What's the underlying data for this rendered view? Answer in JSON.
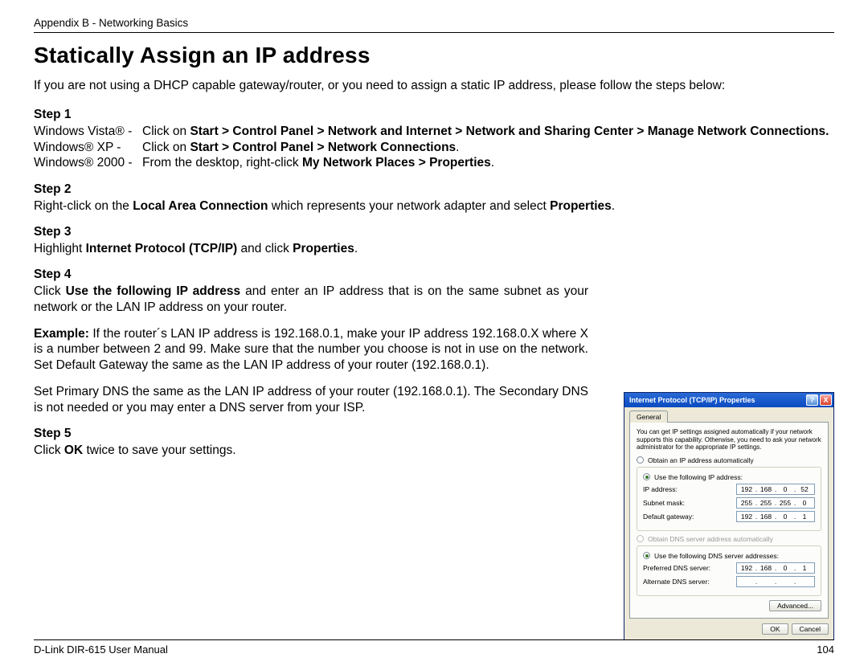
{
  "header": {
    "appendix": "Appendix B - Networking Basics"
  },
  "title": "Statically Assign an IP address",
  "intro": "If you are not using a DHCP capable gateway/router, or you need to assign a static IP address, please follow the steps below:",
  "step1": {
    "label": "Step 1",
    "vista_os": "Windows Vista® -",
    "vista_pre": "Click on ",
    "vista_bold": "Start > Control Panel > Network and Internet > Network and Sharing Center > Manage Network Connections.",
    "xp_os": "Windows® XP -",
    "xp_pre": "Click on ",
    "xp_bold": "Start > Control Panel > Network Connections",
    "xp_post": ".",
    "w2k_os": "Windows® 2000 -",
    "w2k_pre": "From the desktop, right-click ",
    "w2k_bold": "My Network Places > Properties",
    "w2k_post": "."
  },
  "step2": {
    "label": "Step 2",
    "pre": "Right-click on the ",
    "bold1": "Local Area Connection",
    "mid": " which represents your network adapter and select ",
    "bold2": "Properties",
    "post": "."
  },
  "step3": {
    "label": "Step 3",
    "pre": "Highlight ",
    "bold1": "Internet Protocol (TCP/IP)",
    "mid": " and click ",
    "bold2": "Properties",
    "post": "."
  },
  "step4": {
    "label": "Step 4",
    "p1_pre": "Click ",
    "p1_bold": "Use the following IP address",
    "p1_post": " and enter an IP address that is on the same subnet as your network or the LAN IP address on your router.",
    "p2_bold": "Example:",
    "p2_text": " If the router´s LAN IP address is 192.168.0.1, make your IP address 192.168.0.X where X is a number between 2 and 99. Make sure that the number you choose is not in use on the network. Set Default Gateway the same as the LAN IP address of your router (192.168.0.1).",
    "p3_text": "Set Primary DNS the same as the LAN IP address of your router (192.168.0.1). The Secondary DNS is not needed or you may enter a DNS server from your ISP."
  },
  "step5": {
    "label": "Step 5",
    "pre": "Click ",
    "bold": "OK",
    "post": " twice to save your settings."
  },
  "footer": {
    "manual": "D-Link DIR-615 User Manual",
    "page": "104"
  },
  "dialog": {
    "title": "Internet Protocol (TCP/IP) Properties",
    "help_icon": "?",
    "close_icon": "X",
    "tab": "General",
    "desc": "You can get IP settings assigned automatically if your network supports this capability. Otherwise, you need to ask your network administrator for the appropriate IP settings.",
    "radio_auto_ip": "Obtain an IP address automatically",
    "radio_use_ip": "Use the following IP address:",
    "lbl_ip": "IP address:",
    "lbl_mask": "Subnet mask:",
    "lbl_gw": "Default gateway:",
    "radio_auto_dns": "Obtain DNS server address automatically",
    "radio_use_dns": "Use the following DNS server addresses:",
    "lbl_pref_dns": "Preferred DNS server:",
    "lbl_alt_dns": "Alternate DNS server:",
    "ip": {
      "a": "192",
      "b": "168",
      "c": "0",
      "d": "52"
    },
    "mask": {
      "a": "255",
      "b": "255",
      "c": "255",
      "d": "0"
    },
    "gw": {
      "a": "192",
      "b": "168",
      "c": "0",
      "d": "1"
    },
    "pdns": {
      "a": "192",
      "b": "168",
      "c": "0",
      "d": "1"
    },
    "adns": {
      "a": "",
      "b": "",
      "c": "",
      "d": ""
    },
    "btn_advanced": "Advanced...",
    "btn_ok": "OK",
    "btn_cancel": "Cancel"
  }
}
